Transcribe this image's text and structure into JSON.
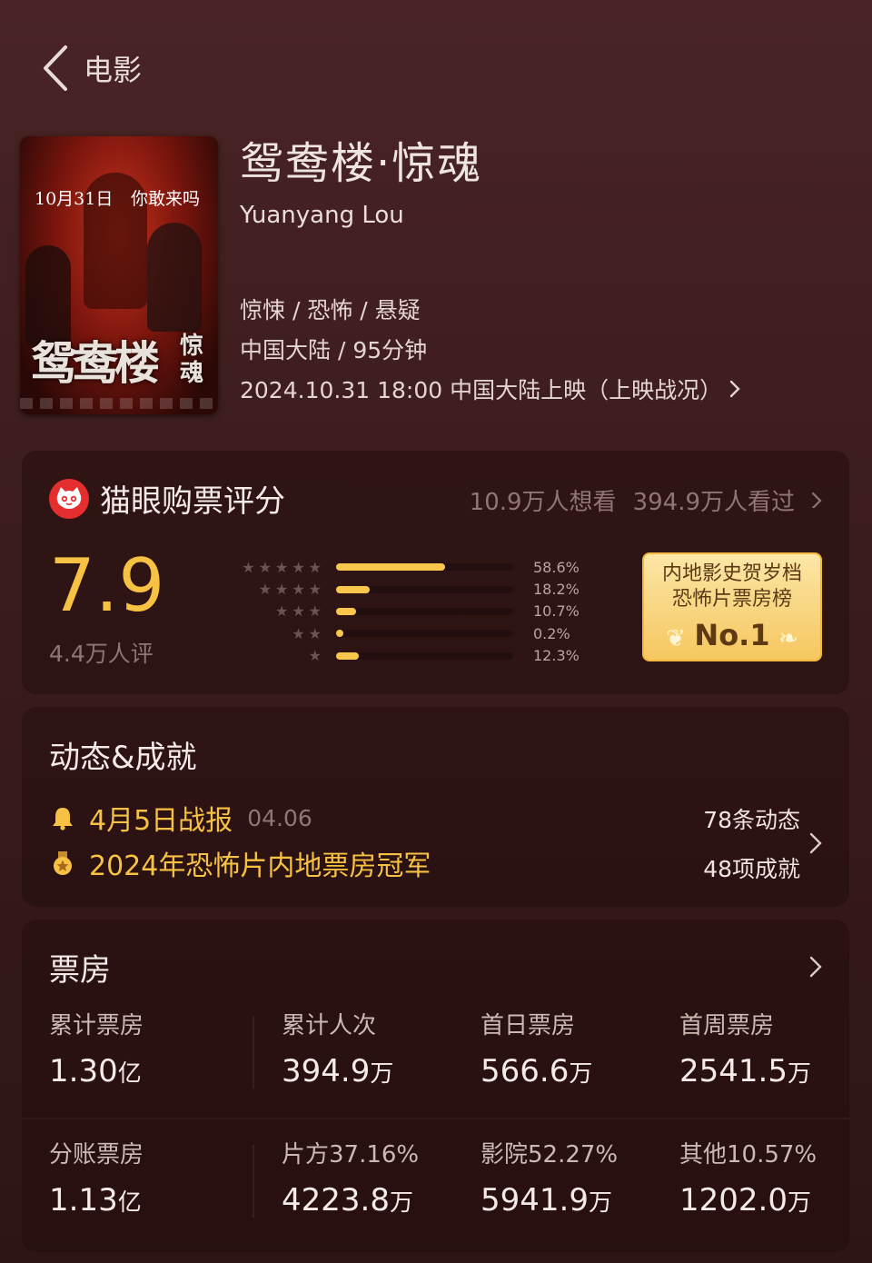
{
  "nav": {
    "title": "电影"
  },
  "movie": {
    "title_zh": "鸳鸯楼·惊魂",
    "title_en": "Yuanyang Lou",
    "genres": "惊悚 / 恐怖 / 悬疑",
    "region_duration": "中国大陆 / 95分钟",
    "release": "2024.10.31 18:00 中国大陆上映（上映战况）"
  },
  "poster": {
    "date_left": "10月31日",
    "date_right": "你敢来吗",
    "title": "鸳鸯楼",
    "subtitle": "惊魂"
  },
  "rating": {
    "section_title": "猫眼购票评分",
    "want_to_see": "10.9万人想看",
    "watched": "394.9万人看过",
    "score": "7.9",
    "score_count": "4.4万人评",
    "distribution": [
      {
        "stars": "★★★★★",
        "pct_label": "58.6%",
        "pct": 58.6
      },
      {
        "stars": "★★★★",
        "pct_label": "18.2%",
        "pct": 18.2
      },
      {
        "stars": "★★★",
        "pct_label": "10.7%",
        "pct": 10.7
      },
      {
        "stars": "★★",
        "pct_label": "0.2%",
        "pct": 0.2
      },
      {
        "stars": "★",
        "pct_label": "12.3%",
        "pct": 12.3
      }
    ],
    "badge": {
      "line1": "内地影史贺岁档",
      "line2": "恐怖片票房榜",
      "rank": "No.1"
    }
  },
  "achievements": {
    "section_title": "动态&成就",
    "items": [
      {
        "text": "4月5日战报",
        "date": "04.06",
        "icon": "bell-icon"
      },
      {
        "text": "2024年恐怖片内地票房冠军",
        "date": "",
        "icon": "medal-icon"
      }
    ],
    "dynamics_count": "78条动态",
    "achievements_count": "48项成就"
  },
  "box_office": {
    "section_title": "票房",
    "row1": [
      {
        "label": "累计票房",
        "value": "1.30",
        "unit": "亿"
      },
      {
        "label": "累计人次",
        "value": "394.9",
        "unit": "万"
      },
      {
        "label": "首日票房",
        "value": "566.6",
        "unit": "万"
      },
      {
        "label": "首周票房",
        "value": "2541.5",
        "unit": "万"
      }
    ],
    "row2": [
      {
        "label": "分账票房",
        "value": "1.13",
        "unit": "亿"
      },
      {
        "label": "片方37.16%",
        "value": "4223.8",
        "unit": "万"
      },
      {
        "label": "影院52.27%",
        "value": "5941.9",
        "unit": "万"
      },
      {
        "label": "其他10.57%",
        "value": "1202.0",
        "unit": "万"
      }
    ]
  },
  "colors": {
    "accent_gold": "#f7c144",
    "maoyan_red": "#e52f2f",
    "background": "#3d1d1d"
  }
}
